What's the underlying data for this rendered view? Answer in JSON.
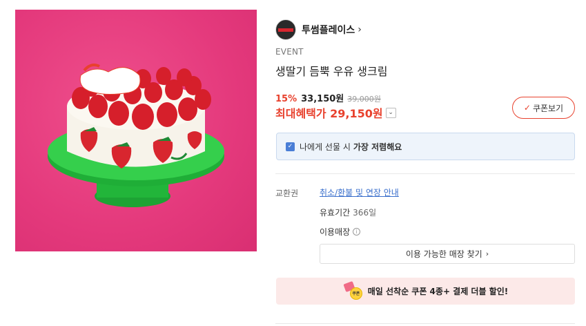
{
  "brand": {
    "name": "투썸플레이스",
    "chevron": "›"
  },
  "product": {
    "event_label": "EVENT",
    "title": "생딸기 듬뿍 우유 생크림",
    "image_alt": "strawberry-cake-image"
  },
  "price": {
    "discount": "15%",
    "sale": "33,150원",
    "original": "39,000원",
    "max_benefit_label": "최대혜택가 29,150원",
    "max_chevron": "⌄"
  },
  "coupon_button": {
    "check": "✓",
    "label": "쿠폰보기"
  },
  "gift_banner": {
    "icon": "✓",
    "text": "나에게 선물 시",
    "strong": "가장 저렴해요"
  },
  "details": {
    "exchange_label": "교환권",
    "exchange_link": "취소/환불 및 연장 안내",
    "validity_label": "유효기간",
    "validity_value": "366일",
    "store_label": "이용매장",
    "info_icon": "i"
  },
  "find_store": {
    "label": "이용 가능한 매장 찾기",
    "chevron": "›"
  },
  "promo": {
    "coin_text": "쿠폰",
    "text": "매일 선착순 쿠폰 4종+ 결제 더블 할인!"
  },
  "colors": {
    "accent_red": "#e8412d",
    "link_blue": "#3a6fcc",
    "image_bg": "#e4397c",
    "cake_stand": "#2ec843"
  }
}
